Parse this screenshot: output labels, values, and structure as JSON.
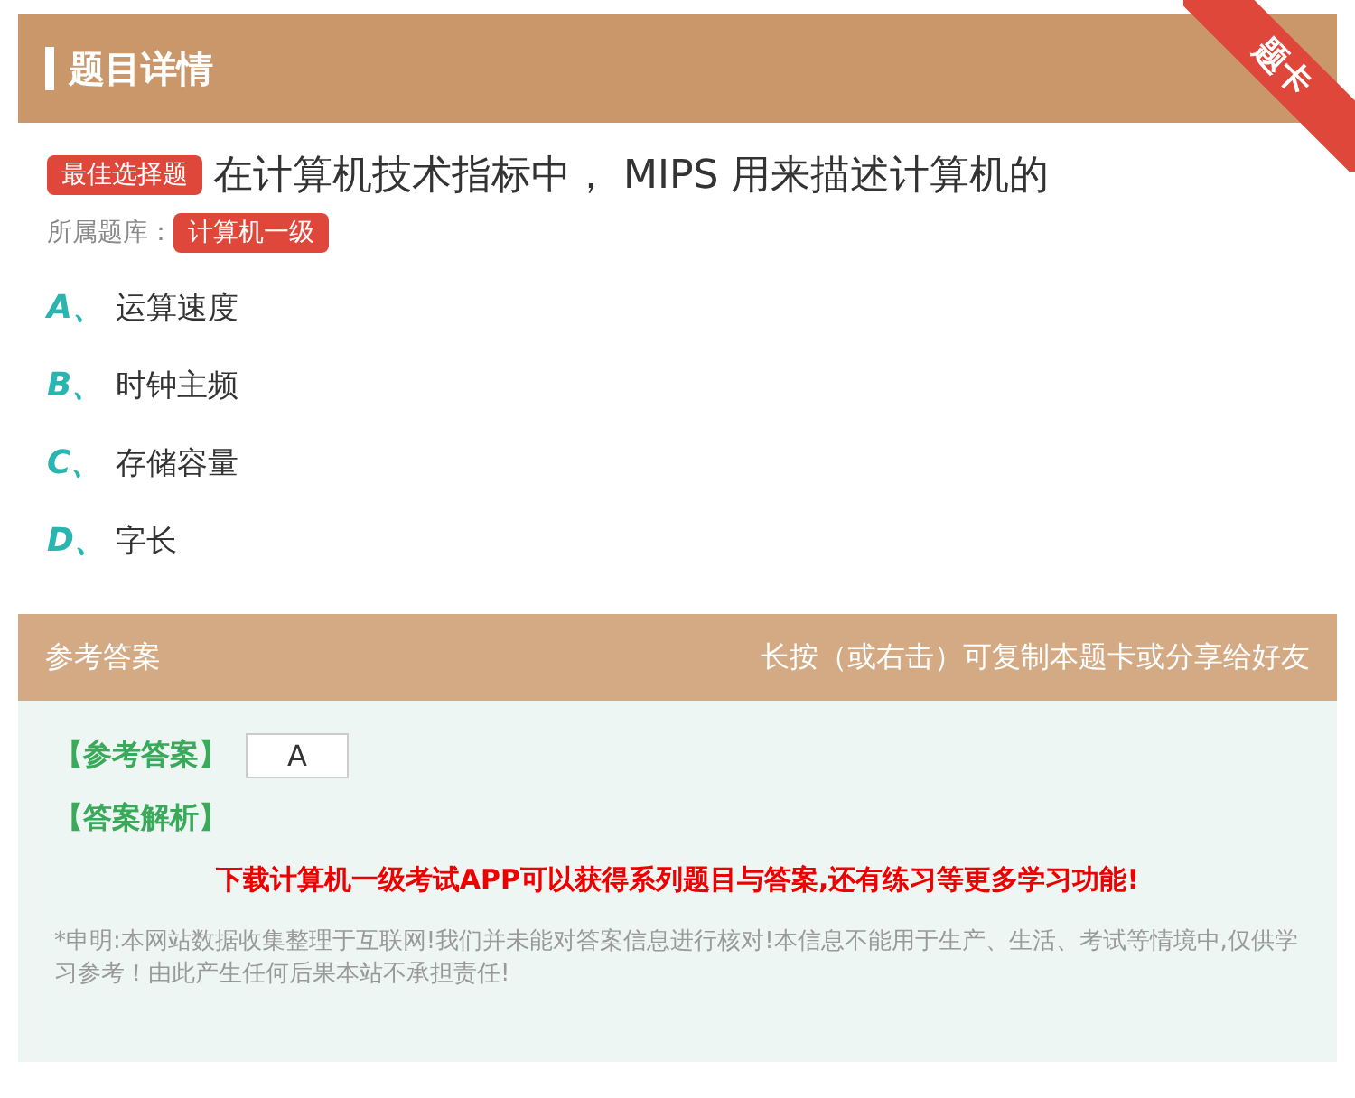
{
  "header": {
    "title": "题目详情",
    "ribbon": "题卡"
  },
  "question": {
    "type_badge": "最佳选择题",
    "text": "在计算机技术指标中， MIPS 用来描述计算机的",
    "bank_label": "所属题库：",
    "bank": "计算机一级"
  },
  "options": [
    {
      "letter": "A、",
      "text": "运算速度"
    },
    {
      "letter": "B、",
      "text": "时钟主频"
    },
    {
      "letter": "C、",
      "text": "存储容量"
    },
    {
      "letter": "D、",
      "text": "字长"
    }
  ],
  "answer_panel": {
    "title": "参考答案",
    "hint": "长按（或右击）可复制本题卡或分享给好友",
    "answer_label": "【参考答案】",
    "answer": "A",
    "analysis_label": "【答案解析】",
    "promo": "下载计算机一级考试APP可以获得系列题目与答案,还有练习等更多学习功能!",
    "disclaimer": "*申明:本网站数据收集整理于互联网!我们并未能对答案信息进行核对!本信息不能用于生产、生活、考试等情境中,仅供学习参考！由此产生任何后果本站不承担责任!"
  }
}
